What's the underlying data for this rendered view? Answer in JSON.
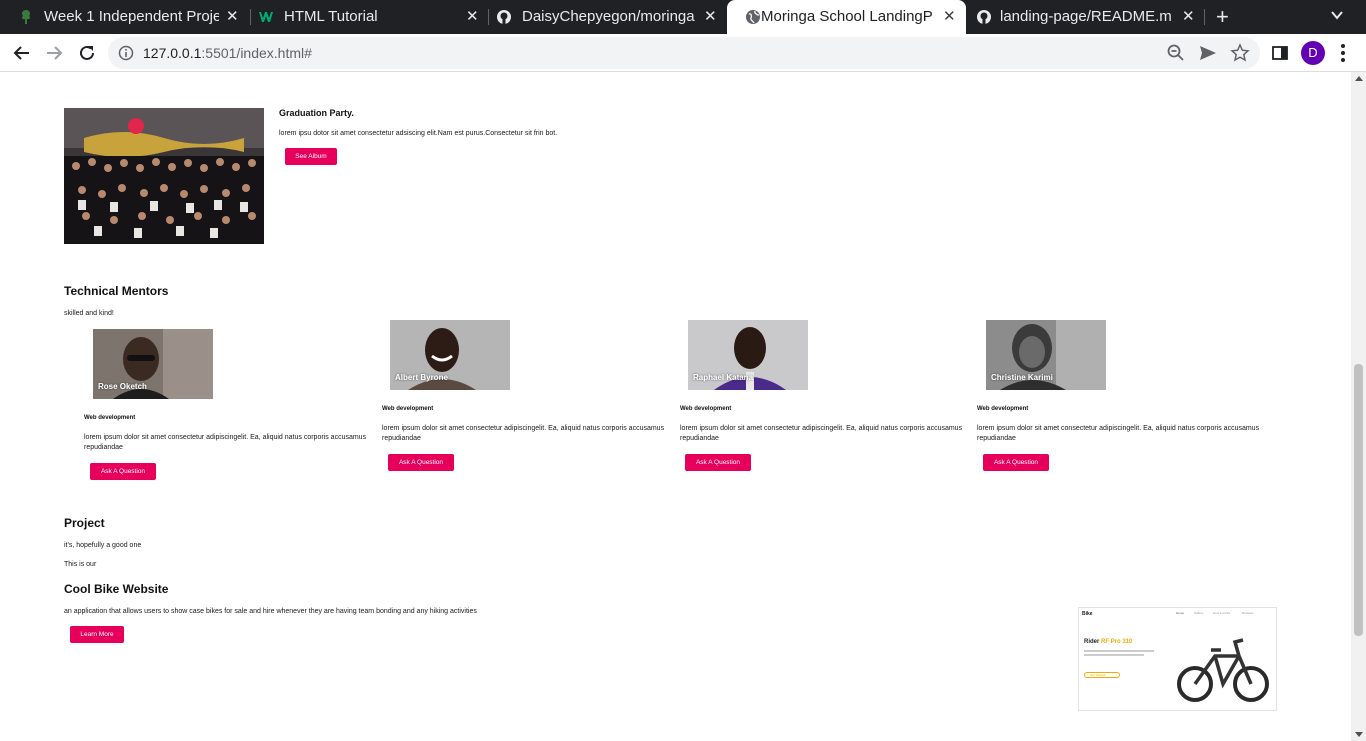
{
  "browser": {
    "tabs": [
      {
        "title": "Week 1 Independent Proje",
        "active": false
      },
      {
        "title": "HTML Tutorial",
        "active": false
      },
      {
        "title": "DaisyChepyegon/moringa",
        "active": false
      },
      {
        "title": "Moringa School LandingP",
        "active": true
      },
      {
        "title": "landing-page/README.m",
        "active": false
      }
    ],
    "url_host": "127.0.0.1",
    "url_rest": ":5501/index.html#",
    "profile_initial": "D"
  },
  "graduation": {
    "title": "Graduation Party.",
    "text": "lorem ipsu dotor sit amet consectetur adsiscing elit.Nam est purus.Consectetur sit frin bot.",
    "button": "See Album"
  },
  "mentors_section": {
    "title": "Technical Mentors",
    "subtitle": "skilled and kind!",
    "mentors": [
      {
        "name": "Rose Oketch",
        "role": "Web development",
        "desc": "lorem ipsum dolor sit amet consectetur adipiscingelit. Ea, aliquid natus corporis accusamus repudiandae",
        "button": "Ask A Question"
      },
      {
        "name": "Albert Byrone",
        "role": "Web development",
        "desc": "lorem ipsum dolor sit amet consectetur adipiscingelit. Ea, aliquid natus corporis accusamus repudiandae",
        "button": "Ask A Question"
      },
      {
        "name": "Raphael Katana",
        "role": "Web development",
        "desc": "lorem ipsum dolor sit amet consectetur adipiscingelit. Ea, aliquid natus corporis accusamus repudiandae",
        "button": "Ask A Question"
      },
      {
        "name": "Christine Karimi",
        "role": "Web development",
        "desc": "lorem ipsum dolor sit amet consectetur adipiscingelit. Ea, aliquid natus corporis accusamus repudiandae",
        "button": "Ask A Question"
      }
    ]
  },
  "project": {
    "title": "Project",
    "subtitle": "it's, hopefully a good one",
    "intro": "This is our",
    "name": "Cool Bike Website",
    "description": "an application that allows users to show case bikes for sale and hire whenever they are having team bonding and any hiking activities",
    "button": "Learn More",
    "screenshot": {
      "logo": "Bike",
      "nav": [
        "Home",
        "Gallery",
        "How it works",
        "Reviews"
      ],
      "headline_a": "Rider",
      "headline_b": "RF Pro 310",
      "button": "Get Started"
    }
  },
  "colors": {
    "accent": "#e6005c",
    "chrome_dark": "#202124",
    "profile": "#6200b3"
  }
}
